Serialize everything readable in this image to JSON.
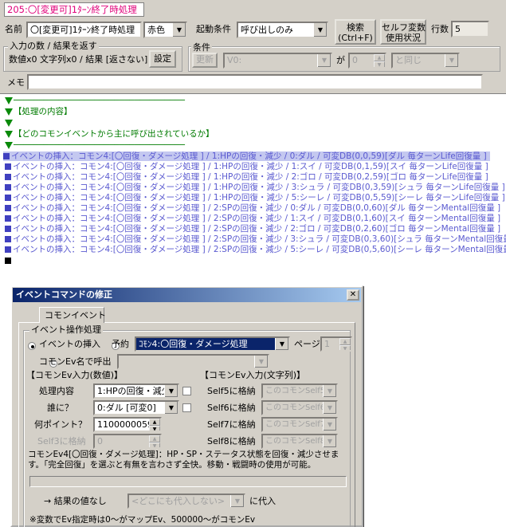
{
  "title_tag": "205:〇[変更可]1ﾀｰﾝ終了時処理",
  "header": {
    "name_label": "名前",
    "name_value": "〇[変更可]1ﾀｰﾝ終了時処理",
    "color_value": "赤色",
    "trigger_label": "起動条件",
    "trigger_value": "呼び出しのみ",
    "search_button": "検索",
    "search_button_shortcut": "(Ctrl+F)",
    "selfvar_button_line1": "セルフ変数",
    "selfvar_button_line2": "使用状況",
    "lines_label": "行数",
    "lines_value": "5",
    "input_group_title": "入力の数 / 結果を返す",
    "input_summary": "数値x0 文字列x0 / 結果 [返さない]",
    "settings_button": "設定",
    "condition_group_title": "条件",
    "update_button": "更新",
    "cond_var_value": "V0:",
    "cond_ga": "が",
    "cond_number": "0",
    "cond_op": "と同じ",
    "memo_label": "メモ",
    "memo_value": ""
  },
  "event_list": {
    "comment_lines": [
      {
        "type": "divider",
        "text": "──────────────────────────────────"
      },
      {
        "type": "comment",
        "text": "【処理の内容】"
      },
      {
        "type": "blank",
        "text": ""
      },
      {
        "type": "comment",
        "text": "【どのコモンイベントから主に呼び出されているか】"
      },
      {
        "type": "divider",
        "text": "──────────────────────────────────"
      }
    ],
    "command_lines": [
      "イベントの挿入：コモン4:[〇回復・ダメージ処理 ] / 1:HPの回復・減少 / 0:ダル / 可変DB(0,0,59)[ダル 毎ターンLife回復量 ]",
      "イベントの挿入：コモン4:[〇回復・ダメージ処理 ] / 1:HPの回復・減少 / 1:スイ / 可変DB(0,1,59)[スイ 毎ターンLife回復量 ]",
      "イベントの挿入：コモン4:[〇回復・ダメージ処理 ] / 1:HPの回復・減少 / 2:ゴロ / 可変DB(0,2,59)[ゴロ 毎ターンLife回復量 ]",
      "イベントの挿入：コモン4:[〇回復・ダメージ処理 ] / 1:HPの回復・減少 / 3:シュラ / 可変DB(0,3,59)[シュラ 毎ターンLife回復量 ]",
      "イベントの挿入：コモン4:[〇回復・ダメージ処理 ] / 1:HPの回復・減少 / 5:シーレ / 可変DB(0,5,59)[シーレ 毎ターンLife回復量 ]",
      "イベントの挿入：コモン4:[〇回復・ダメージ処理 ] / 2:SPの回復・減少 / 0:ダル / 可変DB(0,0,60)[ダル 毎ターンMental回復量 ]",
      "イベントの挿入：コモン4:[〇回復・ダメージ処理 ] / 2:SPの回復・減少 / 1:スイ / 可変DB(0,1,60)[スイ 毎ターンMental回復量 ]",
      "イベントの挿入：コモン4:[〇回復・ダメージ処理 ] / 2:SPの回復・減少 / 2:ゴロ / 可変DB(0,2,60)[ゴロ 毎ターンMental回復量 ]",
      "イベントの挿入：コモン4:[〇回復・ダメージ処理 ] / 2:SPの回復・減少 / 3:シュラ / 可変DB(0,3,60)[シュラ 毎ターンMental回復量 ]",
      "イベントの挿入：コモン4:[〇回復・ダメージ処理 ] / 2:SPの回復・減少 / 5:シーレ / 可変DB(0,5,60)[シーレ 毎ターンMental回復量 ]"
    ]
  },
  "dialog": {
    "title": "イベントコマンドの修正",
    "close_glyph": "✕",
    "tab_label": "コモンイベント",
    "group_title": "イベント操作処理",
    "radio_insert": "イベントの挿入",
    "radio_reserve": "予約",
    "common_select": "ｺﾓﾝ4:〇回復・ダメージ処理",
    "page_label": "ページ",
    "page_value": "1",
    "radio_call_by_name": "コモンEv名で呼出",
    "num_input_header": "【コモンEv入力(数値)】",
    "str_input_header": "【コモンEv入力(文字列)】",
    "field_1_label": "処理内容",
    "field_1_value": "1:HPの回復・減少",
    "field_2_label": "誰に？",
    "field_2_value": "0:ダル [可変0]",
    "field_3_label": "何ポイント？",
    "field_3_value": "1100000059",
    "field_4_label": "Self3に格納",
    "field_4_value": "0",
    "self5_label": "Self5に格納",
    "self6_label": "Self6に格納",
    "self7_label": "Self7に格納",
    "self8_label": "Self8に格納",
    "self5_value": "このコモンSelf5",
    "self6_value": "このコモンSelf6",
    "self7_value": "このコモンSelf7",
    "self8_value": "このコモンSelf8",
    "description": "コモンEv4[〇回復・ダメージ処理]：HP・SP・ステータス状態を回復・減少させます。「完全回復」を選ぶと有無を言わさず全快。移動・戦闘時の使用が可能。",
    "result_label": "→ 結果の値なし",
    "result_select": "<どこにも代入しない>",
    "result_suffix": "に代入",
    "note": "※変数でEv指定時は0～がマップEv、500000～がコモンEv"
  },
  "colors": {
    "window_bg": "#d4d0c8",
    "title_tag": "#e0007a",
    "comment_green": "#007b00",
    "command_blue": "#5a5ad0",
    "dialog_title_bar": "#0a246a"
  }
}
